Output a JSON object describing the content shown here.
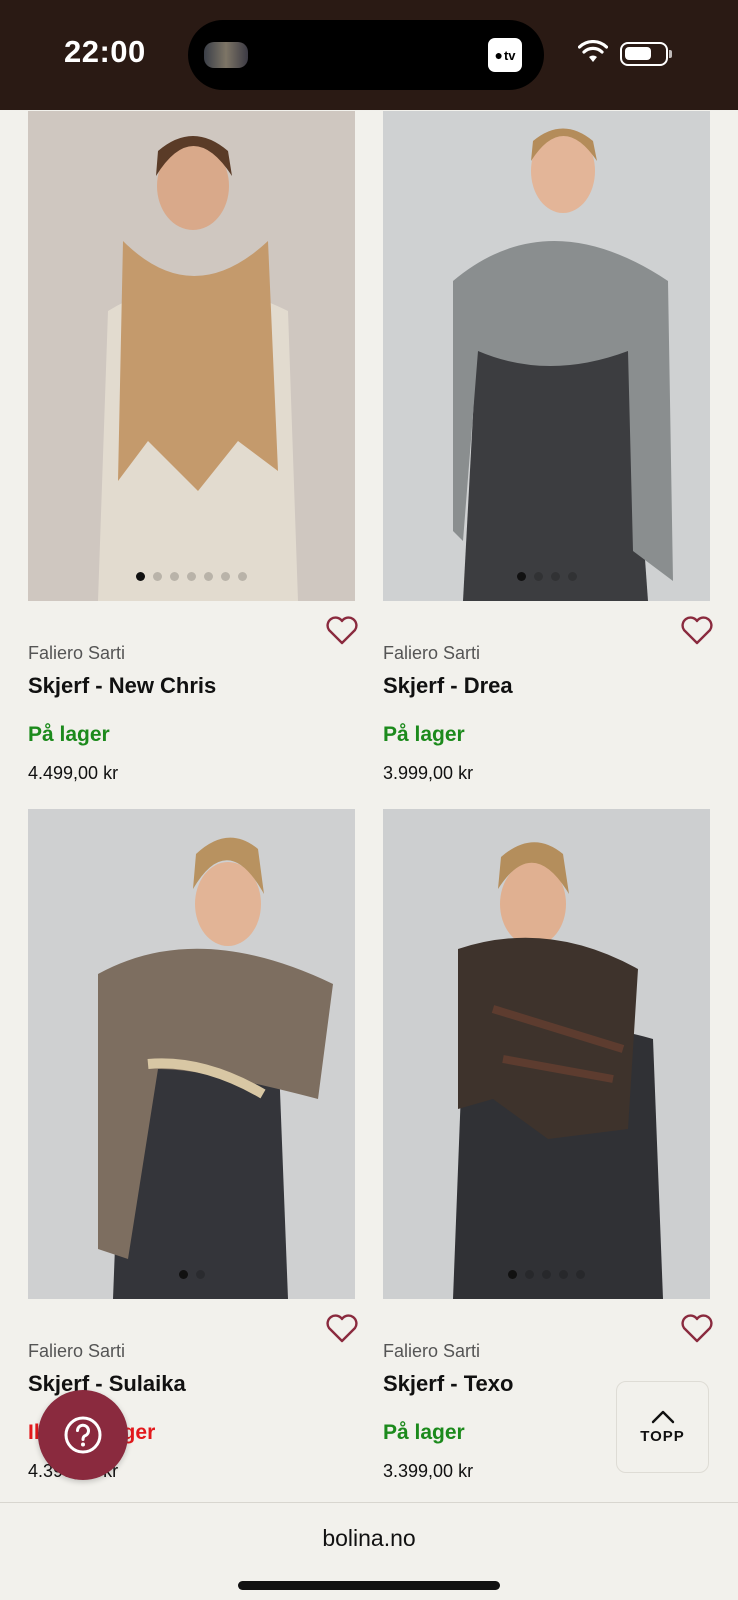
{
  "status_bar": {
    "time": "22:00",
    "tv_label": "tv"
  },
  "products": [
    {
      "brand": "Faliero Sarti",
      "name": "Skjerf - New Chris",
      "stock": "På lager",
      "in_stock": true,
      "price": "4.499,00 kr",
      "scarf_color": "#c49a6c"
    },
    {
      "brand": "Faliero Sarti",
      "name": "Skjerf - Drea",
      "stock": "På lager",
      "in_stock": true,
      "price": "3.999,00 kr",
      "scarf_color": "#8a8e8f"
    },
    {
      "brand": "Faliero Sarti",
      "name": "Skjerf - Sulaika",
      "stock": "Ikke på lager",
      "in_stock": false,
      "price": "4.399,00 kr",
      "scarf_color": "#7d6e60"
    },
    {
      "brand": "Faliero Sarti",
      "name": "Skjerf - Texo",
      "stock": "På lager",
      "in_stock": true,
      "price": "3.399,00 kr",
      "scarf_color": "#3e332c"
    }
  ],
  "topp_button": {
    "label": "TOPP"
  },
  "browser": {
    "url": "bolina.no"
  },
  "colors": {
    "accent": "#8a2a3e",
    "in_stock": "#1c8a1c",
    "out_of_stock": "#e3191c",
    "status_bar": "#2a1a14"
  }
}
